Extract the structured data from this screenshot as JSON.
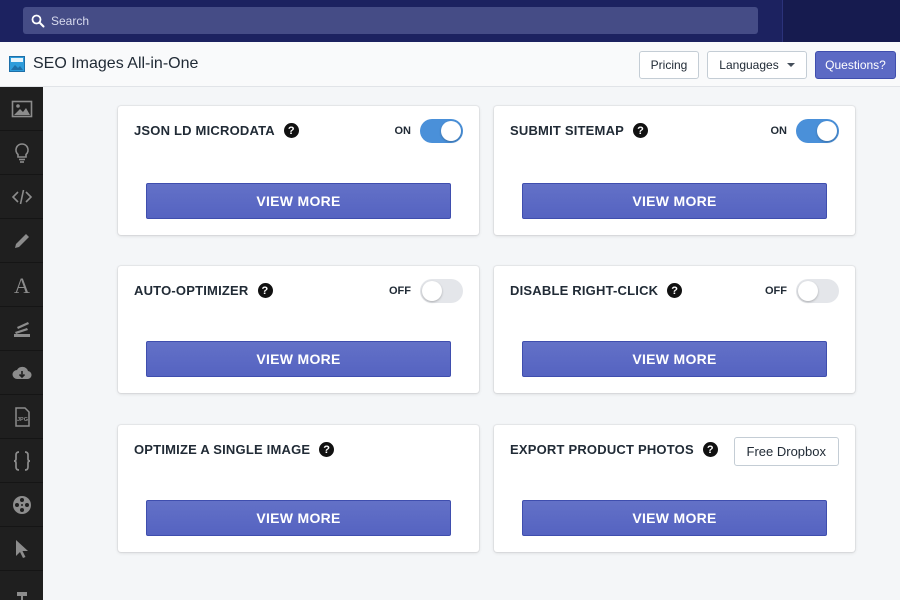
{
  "search": {
    "placeholder": "Search"
  },
  "app": {
    "title": "SEO Images All-in-One",
    "buttons": {
      "pricing": "Pricing",
      "languages": "Languages",
      "questions": "Questions?"
    }
  },
  "sidebar": {
    "items": [
      {
        "icon": "image-icon"
      },
      {
        "icon": "lightbulb-icon"
      },
      {
        "icon": "code-icon"
      },
      {
        "icon": "pencil-icon"
      },
      {
        "icon": "font-icon"
      },
      {
        "icon": "stack-icon"
      },
      {
        "icon": "cloud-download-icon"
      },
      {
        "icon": "jpg-file-icon",
        "label": "JPG"
      },
      {
        "icon": "curly-braces-icon"
      },
      {
        "icon": "film-reel-icon"
      },
      {
        "icon": "cursor-icon"
      }
    ]
  },
  "cards": [
    {
      "title": "JSON LD MICRODATA",
      "toggle": {
        "state": "on",
        "label": "ON"
      },
      "button": "VIEW MORE"
    },
    {
      "title": "SUBMIT SITEMAP",
      "toggle": {
        "state": "on",
        "label": "ON"
      },
      "button": "VIEW MORE"
    },
    {
      "title": "AUTO-OPTIMIZER",
      "toggle": {
        "state": "off",
        "label": "OFF"
      },
      "button": "VIEW MORE"
    },
    {
      "title": "DISABLE RIGHT-CLICK",
      "toggle": {
        "state": "off",
        "label": "OFF"
      },
      "button": "VIEW MORE"
    },
    {
      "title": "OPTIMIZE A SINGLE IMAGE",
      "button": "VIEW MORE"
    },
    {
      "title": "EXPORT PRODUCT PHOTOS",
      "extra_button": "Free Dropbox",
      "button": "VIEW MORE"
    }
  ],
  "help_glyph": "?",
  "colors": {
    "topbar": "#1c2260",
    "accent": "#5c6ac4",
    "toggle_on": "#4a90d9",
    "sidebar": "#1f1f1f"
  }
}
